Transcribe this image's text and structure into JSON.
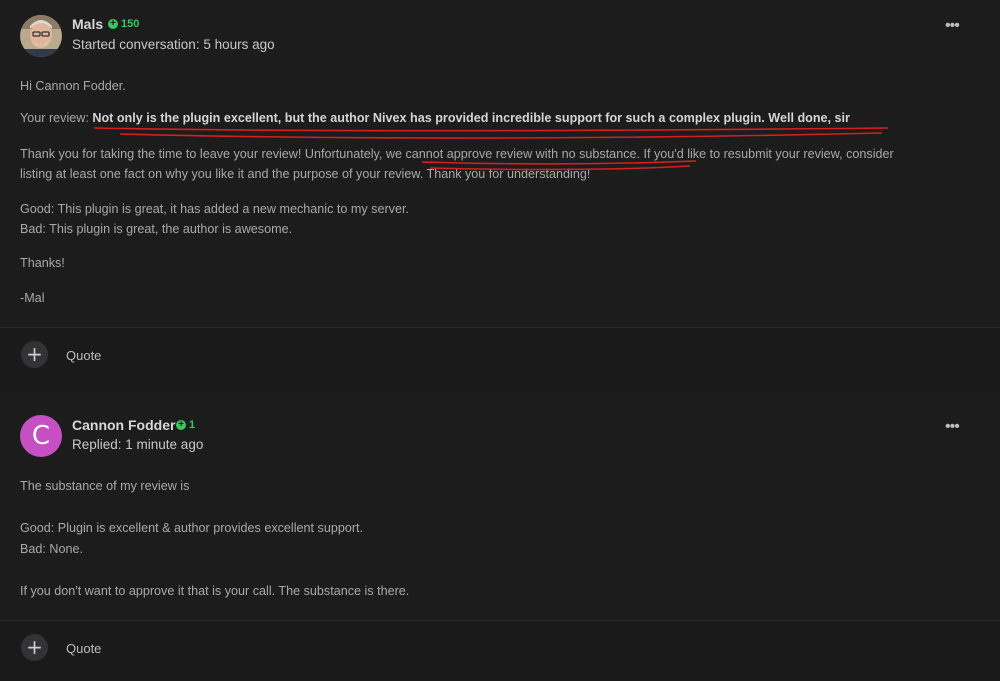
{
  "post1": {
    "author": "Mals",
    "reputation": "150",
    "meta": "Started conversation: 5 hours ago",
    "more_label": "•••",
    "greeting": "Hi Cannon Fodder.",
    "review_prefix": "Your review: ",
    "review_text": "Not only is the plugin excellent, but the author Nivex has provided incredible support for such a complex plugin. Well done, sir",
    "para1_a": "Thank you for taking the time to leave your review! Unfortunately, ",
    "para1_b": "we cannot approve review with no substance.",
    "para1_c": " If you'd like to resubmit your review, consider",
    "para1_line2": "listing at least one fact on why you like it and the purpose of your review. Thank you for understanding!",
    "good": "Good: This plugin is great, it has added a new mechanic to my server.",
    "bad": "Bad: This plugin is great, the author is awesome.",
    "thanks": "Thanks!",
    "sign": "-Mal",
    "footer": {
      "plus": "+",
      "quote": "Quote"
    }
  },
  "post2": {
    "author": "Cannon Fodder",
    "avatar_letter": "C",
    "reputation": "1",
    "meta": "Replied: 1 minute ago",
    "more_label": "•••",
    "line1": "The substance of my review is",
    "good": "Good:  Plugin is excellent & author provides excellent support.",
    "bad": "Bad: None.",
    "line4": "If you don't want to approve it that is your call.  The substance is there.",
    "footer": {
      "plus": "+",
      "quote": "Quote"
    }
  },
  "colors": {
    "background": "#1a1a1b",
    "reputation": "#38c95e",
    "avatar_c": "#c74fc4",
    "annotation": "#d61f1f"
  }
}
